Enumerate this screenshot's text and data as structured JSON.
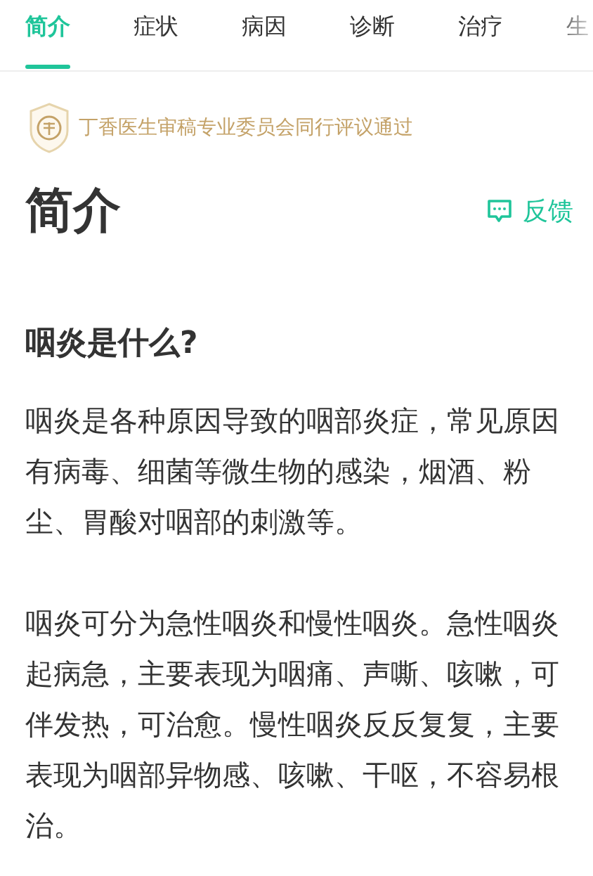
{
  "tabs": [
    {
      "label": "简介",
      "selected": true
    },
    {
      "label": "症状",
      "selected": false
    },
    {
      "label": "病因",
      "selected": false
    },
    {
      "label": "诊断",
      "selected": false
    },
    {
      "label": "治疗",
      "selected": false
    },
    {
      "label": "生",
      "selected": false
    }
  ],
  "review_badge": {
    "text": "丁香医生审稿专业委员会同行评议通过"
  },
  "title": "简介",
  "feedback_button": {
    "label": "反馈"
  },
  "section": {
    "heading": "咽炎是什么?",
    "paragraphs": [
      "咽炎是各种原因导致的咽部炎症，常见原因有病毒、细菌等微生物的感染，烟酒、粉尘、胃酸对咽部的刺激等。",
      "咽炎可分为急性咽炎和慢性咽炎。急性咽炎起病急，主要表现为咽痛、声嘶、咳嗽，可伴发热，可治愈。慢性咽炎反反复复，主要表现为咽部异物感、咳嗽、干呕，不容易根治。"
    ]
  }
}
